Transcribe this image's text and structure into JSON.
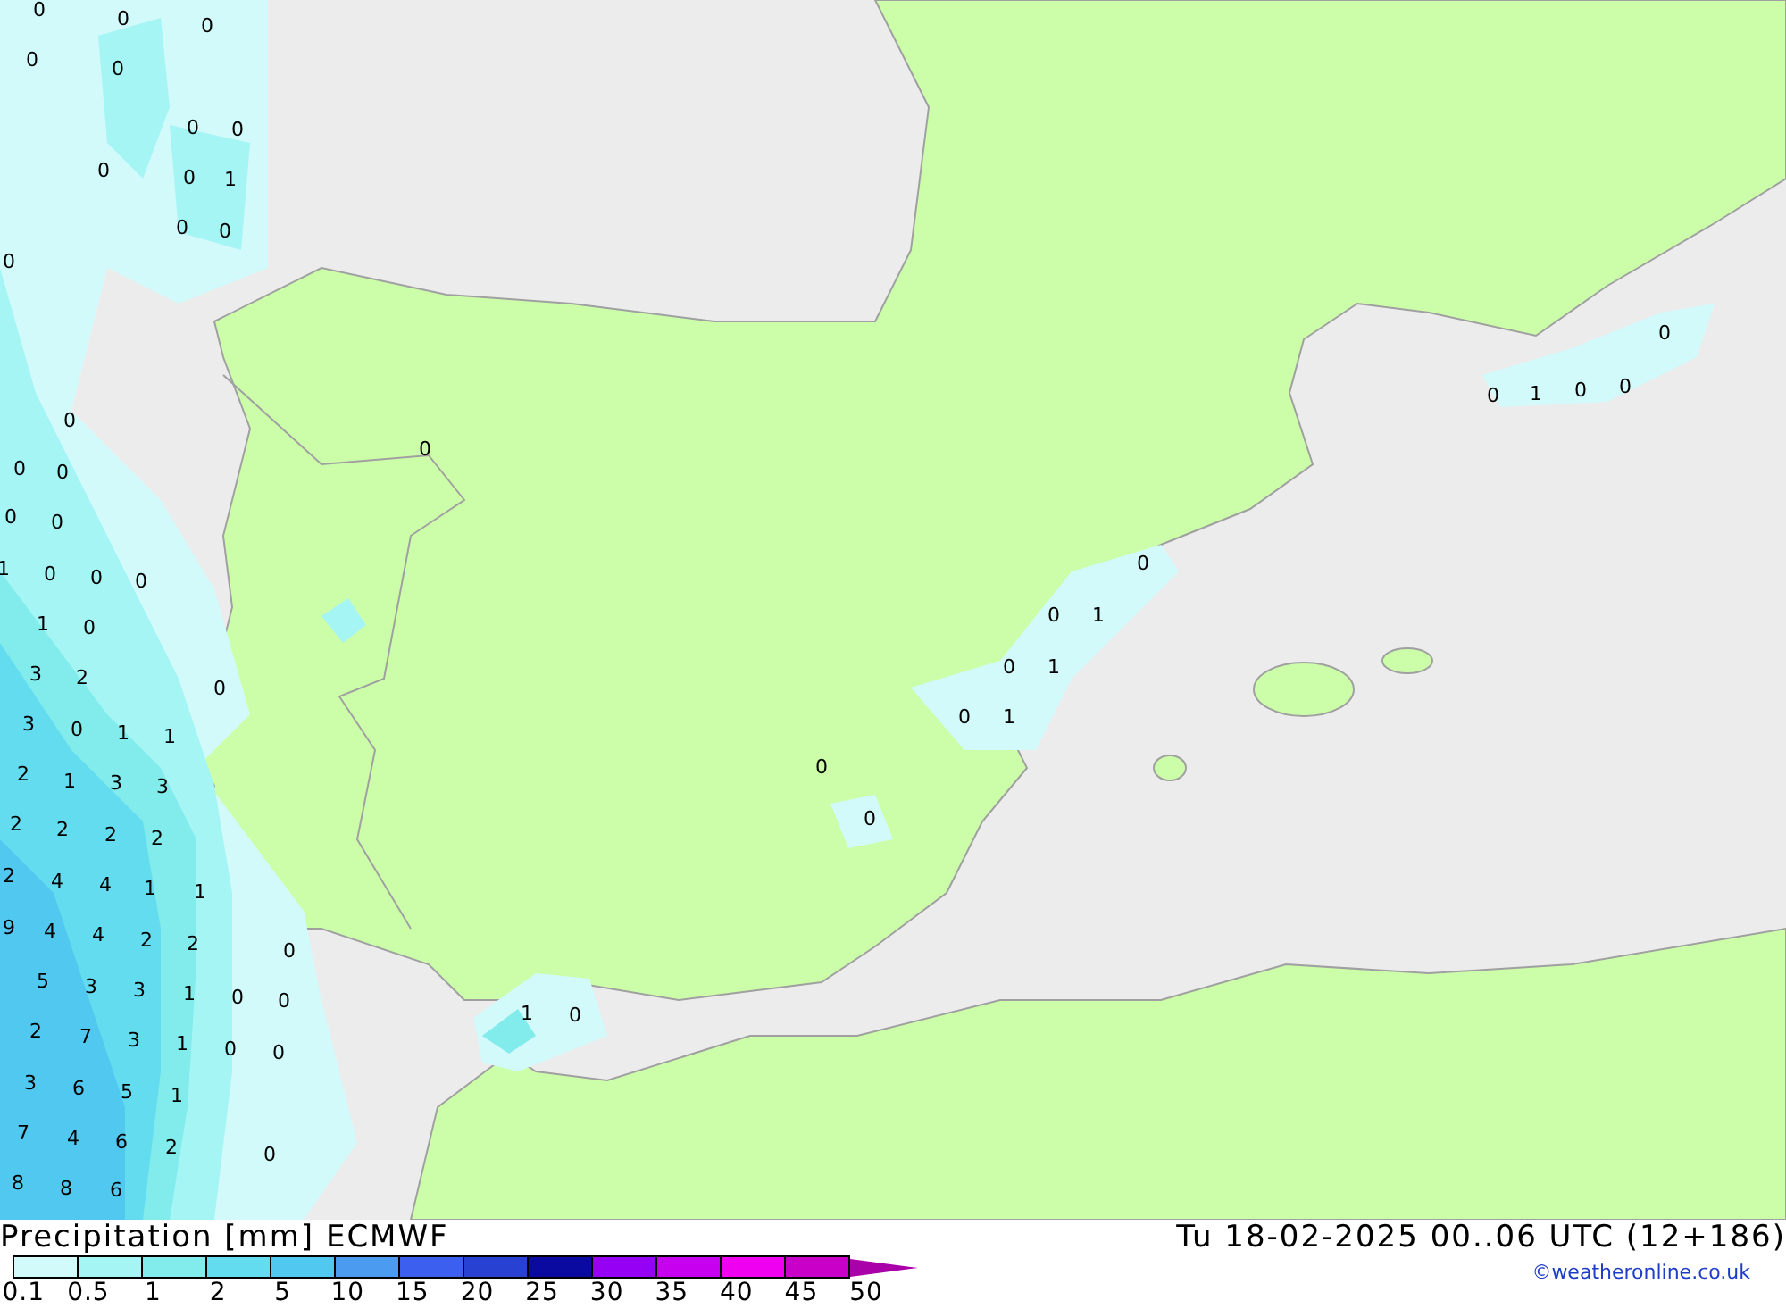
{
  "map": {
    "values": [
      "0",
      "0",
      "0",
      "0",
      "0",
      "0",
      "0",
      "0",
      "0",
      "1",
      "0",
      "0",
      "0",
      "0",
      "0",
      "0",
      "0",
      "0",
      "1",
      "0",
      "0",
      "0",
      "1",
      "0",
      "3",
      "2",
      "3",
      "0",
      "1",
      "1",
      "2",
      "1",
      "3",
      "3",
      "2",
      "2",
      "2",
      "2",
      "2",
      "4",
      "4",
      "1",
      "1",
      "9",
      "4",
      "4",
      "2",
      "2",
      "0",
      "5",
      "3",
      "3",
      "1",
      "0",
      "0",
      "2",
      "7",
      "3",
      "1",
      "0",
      "0",
      "3",
      "6",
      "5",
      "1",
      "7",
      "4",
      "6",
      "2",
      "0",
      "8",
      "8",
      "6",
      "0",
      "0",
      "0",
      "0",
      "1",
      "0",
      "1",
      "0",
      "1",
      "0",
      "0",
      "1",
      "0",
      "0",
      "1",
      "0",
      "0",
      "0"
    ]
  },
  "title": "Precipitation [mm] ECMWF",
  "valid_time": "Tu 18-02-2025 00..06 UTC (12+186)",
  "legend": {
    "segments": [
      {
        "kind": "swatch",
        "color": "#d2fafa"
      },
      {
        "kind": "swatch",
        "color": "#a5f5f5"
      },
      {
        "kind": "swatch",
        "color": "#82ebeb"
      },
      {
        "kind": "swatch",
        "color": "#64dcf0"
      },
      {
        "kind": "swatch",
        "color": "#50c8f0"
      },
      {
        "kind": "swatch",
        "color": "#4b9bf0"
      },
      {
        "kind": "swatch",
        "color": "#3c5ff0"
      },
      {
        "kind": "swatch",
        "color": "#2841d2"
      },
      {
        "kind": "swatch",
        "color": "#0a0aa0"
      },
      {
        "kind": "swatch",
        "color": "#9600f5"
      },
      {
        "kind": "swatch",
        "color": "#c800f0"
      },
      {
        "kind": "swatch",
        "color": "#f000f0"
      },
      {
        "kind": "swatch",
        "color": "#c800c8"
      },
      {
        "kind": "arrow",
        "color": "#aa00aa"
      }
    ],
    "labels": [
      "0.1",
      "0.5",
      "1",
      "2",
      "5",
      "10",
      "15",
      "20",
      "25",
      "30",
      "35",
      "40",
      "45",
      "50"
    ]
  },
  "credit": "©weatheronline.co.uk"
}
